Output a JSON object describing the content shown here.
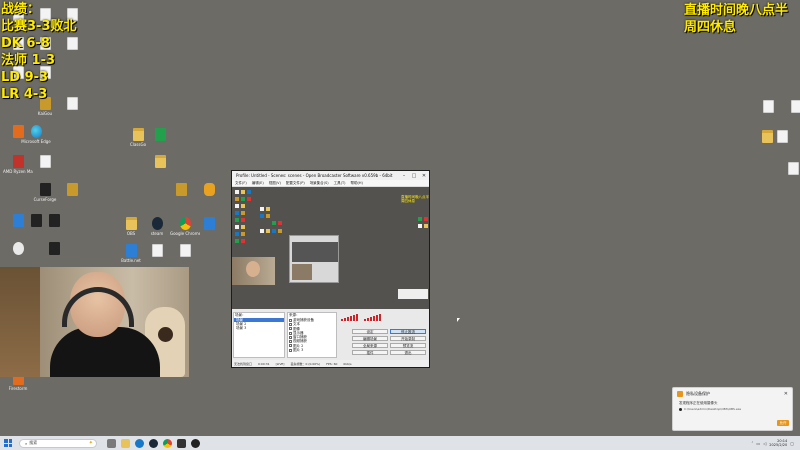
{
  "overlay": {
    "left_lines": [
      "战绩：",
      "比赛3-3败北",
      "DK 6-8",
      "法师 1-3",
      "LD 9-3",
      "LR 4-3"
    ],
    "right_lines": [
      "直播时间晚八点半",
      "周四休息"
    ]
  },
  "desktop_icons": [
    {
      "name": "file",
      "label": "",
      "kind": "file"
    },
    {
      "name": "file",
      "label": "",
      "kind": "file"
    },
    {
      "name": "file",
      "label": "",
      "kind": "file"
    },
    {
      "name": "file",
      "label": "",
      "kind": "file"
    },
    {
      "name": "file",
      "label": "",
      "kind": "file"
    },
    {
      "name": "file",
      "label": "",
      "kind": "file"
    },
    {
      "name": "file",
      "label": "",
      "kind": "file"
    },
    {
      "name": "file",
      "label": "",
      "kind": "file"
    },
    {
      "name": "edge",
      "label": "Microsoft Edge",
      "kind": "edge"
    },
    {
      "name": "kaiyu",
      "label": "KaiGou",
      "kind": "gold"
    },
    {
      "name": "file",
      "label": "",
      "kind": "file"
    },
    {
      "name": "app",
      "label": "",
      "kind": "orange"
    },
    {
      "name": "amd",
      "label": "AMD Ryzen Master",
      "kind": "red"
    },
    {
      "name": "file",
      "label": "",
      "kind": "file"
    },
    {
      "name": "curseforge",
      "label": "CurseForge",
      "kind": "dark"
    },
    {
      "name": "wow",
      "label": "",
      "kind": "gold"
    },
    {
      "name": "app",
      "label": "",
      "kind": "blue"
    },
    {
      "name": "app",
      "label": "",
      "kind": "dark"
    },
    {
      "name": "app",
      "label": "",
      "kind": "dark"
    },
    {
      "name": "app",
      "label": "",
      "kind": "white"
    },
    {
      "name": "app",
      "label": "",
      "kind": "dark"
    },
    {
      "name": "folder",
      "label": "ClassGo",
      "kind": "folder"
    },
    {
      "name": "app",
      "label": "",
      "kind": "green"
    },
    {
      "name": "folder",
      "label": "",
      "kind": "folder"
    },
    {
      "name": "app",
      "label": "",
      "kind": "gold"
    },
    {
      "name": "owl",
      "label": "",
      "kind": "owl"
    },
    {
      "name": "folder",
      "label": "OBS",
      "kind": "folder"
    },
    {
      "name": "steam",
      "label": "steam",
      "kind": "steam"
    },
    {
      "name": "chrome",
      "label": "Google Chrome",
      "kind": "chrome"
    },
    {
      "name": "app",
      "label": "",
      "kind": "blue"
    },
    {
      "name": "battlenet",
      "label": "Battle.net",
      "kind": "blue"
    },
    {
      "name": "file",
      "label": "",
      "kind": "file"
    },
    {
      "name": "file",
      "label": "",
      "kind": "file"
    },
    {
      "name": "file",
      "label": "",
      "kind": "file"
    },
    {
      "name": "file",
      "label": "",
      "kind": "file"
    },
    {
      "name": "file",
      "label": "",
      "kind": "file"
    },
    {
      "name": "folder",
      "label": "",
      "kind": "folder"
    },
    {
      "name": "file",
      "label": "",
      "kind": "file"
    },
    {
      "name": "firestorm",
      "label": "Firestorm",
      "kind": "orange"
    }
  ],
  "obs": {
    "title": "Profile: Untitled - Scenes: scenes - Open Broadcaster Software v0.659b - 64bit",
    "menu": [
      "文件(F)",
      "编辑(E)",
      "视图(V)",
      "配置文件(P)",
      "场景集合(S)",
      "工具(T)",
      "帮助(H)"
    ],
    "preview_text": [
      "直播时间晚八点半",
      "周四休息"
    ],
    "scenes_label": "场景：",
    "scenes": [
      "场景",
      "场景 2",
      "场景 3"
    ],
    "sources_label": "来源：",
    "sources": [
      "游戏捕获设备",
      "文本",
      "图像",
      "显示器",
      "窗口捕获",
      "视频捕获",
      "图片 2",
      "图片 3"
    ],
    "buttons": [
      "设定",
      "停止推流",
      "编辑场景",
      "开始录制",
      "全局来源",
      "预览流",
      "插件",
      "退出"
    ],
    "status": [
      "无法找到窗口",
      "0:00:31",
      "[LIVE]",
      "丢失帧数：0 (0.00%)",
      "FPS: 60",
      "0kb/s"
    ]
  },
  "notification": {
    "title": "隐私设备保护",
    "body": "发现程序正在使用摄像头",
    "path": "C:\\Users\\admin\\Desktop\\OBS\\OBS.exe",
    "button": "允许"
  },
  "taskbar": {
    "search_placeholder": "搜索",
    "time": "20:14",
    "date": "2025/2/20"
  }
}
